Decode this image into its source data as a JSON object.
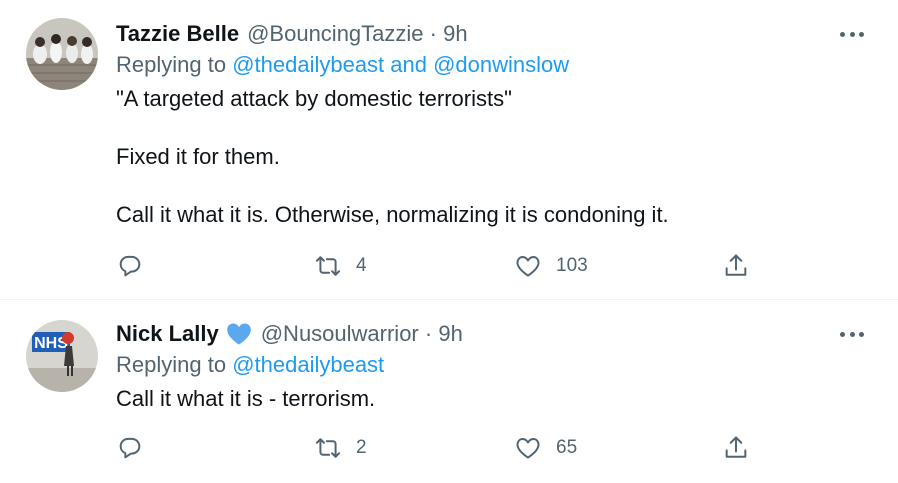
{
  "tweets": [
    {
      "name": "Tazzie Belle",
      "handle": "@BouncingTazzie",
      "time": "9h",
      "replying_prefix": "Replying to ",
      "replying_to": "@thedailybeast and @donwinslow",
      "body": [
        "\"A targeted attack by domestic terrorists\"",
        "Fixed it for them.",
        "Call it what it is. Otherwise, normalizing it is condoning it."
      ],
      "retweets": "4",
      "likes": "103",
      "verified": false
    },
    {
      "name": "Nick Lally",
      "handle": "@Nusoulwarrior",
      "time": "9h",
      "replying_prefix": "Replying to ",
      "replying_to": "@thedailybeast",
      "body": [
        "Call it what it is - terrorism."
      ],
      "retweets": "2",
      "likes": "65",
      "verified": true,
      "avatar_text": "NHS"
    }
  ],
  "separator": " · ",
  "colors": {
    "link": "#1d9bf0",
    "muted": "#536471",
    "text": "#0f1419",
    "verified_heart": "#5aa8ee"
  },
  "icons": {
    "reply": "reply-icon",
    "retweet": "retweet-icon",
    "like": "heart-icon",
    "share": "share-icon",
    "more": "more-options-icon"
  }
}
